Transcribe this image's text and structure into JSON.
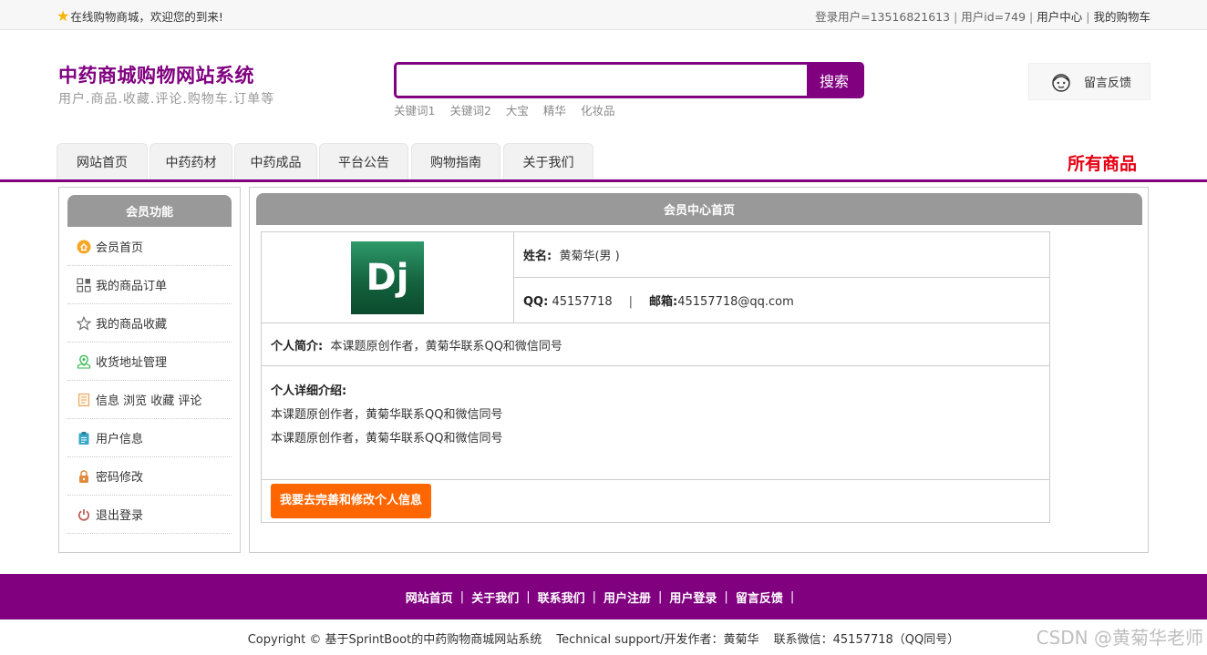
{
  "topbar": {
    "welcome": "在线购物商城，欢迎您的到来!",
    "login_user": "登录用户=13516821613",
    "user_id": "用户id=749",
    "user_center": "用户中心",
    "my_cart": "我的购物车"
  },
  "header": {
    "title": "中药商城购物网站系统",
    "subtitle": "用户.商品.收藏.评论.购物车.订单等",
    "search_placeholder": "",
    "search_button": "搜索",
    "hot_keywords": [
      "关键词1",
      "关键词2",
      "大宝",
      "精华",
      "化妆品"
    ],
    "feedback": "留言反馈"
  },
  "nav": {
    "tabs": [
      "网站首页",
      "中药药材",
      "中药成品",
      "平台公告",
      "购物指南",
      "关于我们"
    ],
    "all_goods": "所有商品"
  },
  "sidebar": {
    "title": "会员功能",
    "items": [
      {
        "label": "会员首页",
        "icon": "home-icon",
        "color": "#f5a623"
      },
      {
        "label": "我的商品订单",
        "icon": "grid-icon",
        "color": "#666666"
      },
      {
        "label": "我的商品收藏",
        "icon": "star-outline-icon",
        "color": "#666666"
      },
      {
        "label": "收货地址管理",
        "icon": "location-pin-icon",
        "color": "#2db84d"
      },
      {
        "label": "信息 浏览 收藏 评论",
        "icon": "document-list-icon",
        "color": "#e8a65c"
      },
      {
        "label": "用户信息",
        "icon": "clipboard-icon",
        "color": "#3aa7c9"
      },
      {
        "label": "密码修改",
        "icon": "lock-icon",
        "color": "#e08a3c"
      },
      {
        "label": "退出登录",
        "icon": "power-icon",
        "color": "#c0605a"
      }
    ]
  },
  "main": {
    "title": "会员中心首页",
    "avatar_text": "Dj",
    "name_label": "姓名:",
    "name_value": "黄菊华(男 )",
    "qq_label": "QQ:",
    "qq_value": "45157718",
    "divider": "|",
    "email_label": "邮箱:",
    "email_value": "45157718@qq.com",
    "intro_label": "个人简介:",
    "intro_value": "本课题原创作者，黄菊华联系QQ和微信同号",
    "detail_label": "个人详细介绍:",
    "detail_lines": [
      "本课题原创作者，黄菊华联系QQ和微信同号",
      "本课题原创作者，黄菊华联系QQ和微信同号"
    ],
    "edit_button": "我要去完善和修改个人信息"
  },
  "footer": {
    "links": [
      "网站首页",
      "关于我们",
      "联系我们",
      "用户注册",
      "用户登录",
      "留言反馈"
    ],
    "sep": "|",
    "copyright": "Copyright © 基于SprintBoot的中药购物商城网站系统",
    "support": "Technical support/开发作者：黄菊华",
    "contact": "联系微信：45157718（QQ同号）",
    "watermark": "CSDN @黄菊华老师"
  },
  "colors": {
    "brand": "#800080",
    "accent_red": "#e60012",
    "button_orange": "#ff6600",
    "panel_header": "#999999"
  }
}
